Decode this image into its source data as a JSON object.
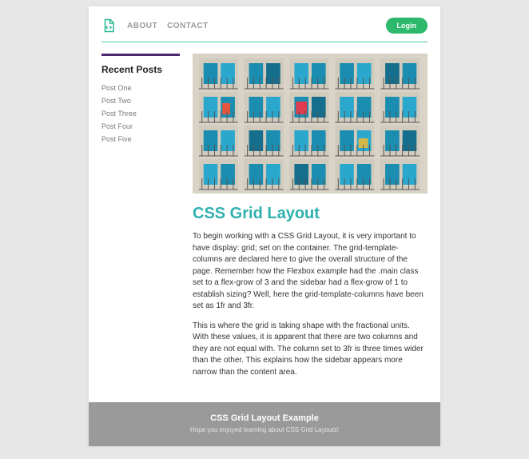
{
  "header": {
    "nav": [
      {
        "label": "ABOUT"
      },
      {
        "label": "CONTACT"
      }
    ],
    "login_label": "Login"
  },
  "sidebar": {
    "title": "Recent Posts",
    "items": [
      {
        "label": "Post One"
      },
      {
        "label": "Post Two"
      },
      {
        "label": "Post Three"
      },
      {
        "label": "Post Four"
      },
      {
        "label": "Post Five"
      }
    ]
  },
  "article": {
    "title": "CSS Grid Layout",
    "p1": "To begin working with a CSS Grid Layout, it is very important to have display: grid; set on the container. The grid-template-columns are declared here to give the overall structure of the page. Remember how the Flexbox example had the .main class set to a flex-grow of 3 and the sidebar had a flex-grow of 1 to establish sizing? Well, here the grid-template-columns have been set as 1fr and 3fr.",
    "p2": "This is where the grid is taking shape with the fractional units. With these values, it is apparent that there are two columns and they are not equal with. The column set to 3fr is three times wider than the other. This explains how the sidebar appears more narrow than the content area."
  },
  "footer": {
    "title": "CSS Grid Layout Example",
    "subtitle": "Hope you enjoyed learning about CSS Grid Layouts!"
  }
}
